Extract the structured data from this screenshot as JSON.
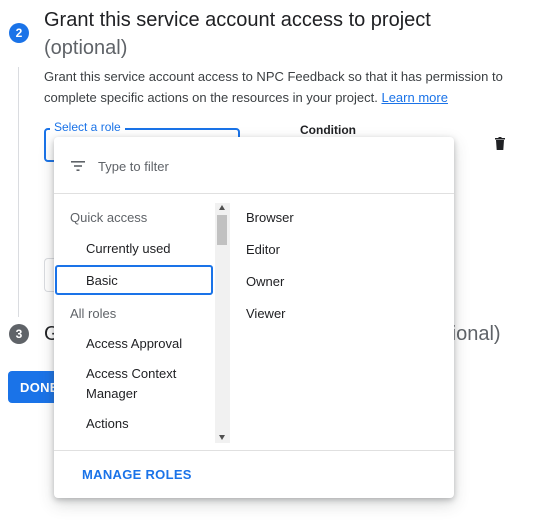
{
  "step2": {
    "number": "2",
    "title": "Grant this service account access to project",
    "optional": "(optional)",
    "description": "Grant this service account access to NPC Feedback so that it has permission to complete specific actions on the resources in your project.",
    "learn_more": "Learn more"
  },
  "role_field": {
    "label": "Select a role"
  },
  "condition_label": "Condition",
  "step3": {
    "number": "3",
    "title_start": "G",
    "title_end": "ptional)"
  },
  "done_button": "DONE",
  "dropdown": {
    "filter_placeholder": "Type to filter",
    "quick_access_label": "Quick access",
    "quick_access_items": [
      "Currently used",
      "Basic"
    ],
    "all_roles_label": "All roles",
    "all_roles_items": [
      "Access Approval",
      "Access Context Manager",
      "Actions"
    ],
    "roles": [
      "Browser",
      "Editor",
      "Owner",
      "Viewer"
    ],
    "manage_roles": "MANAGE ROLES"
  },
  "colors": {
    "accent": "#1a73e8",
    "step_inactive": "#5f6368"
  }
}
